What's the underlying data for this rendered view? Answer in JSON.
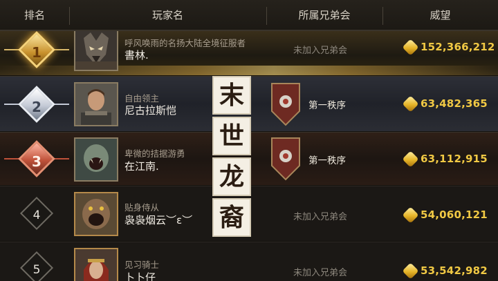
{
  "header": {
    "rank": "排名",
    "player": "玩家名",
    "guild": "所属兄弟会",
    "prestige": "威望"
  },
  "rows": [
    {
      "rank": "1",
      "title": "呼风唤雨的名扬大陆全境征服者",
      "name": "書林.",
      "guild": "未加入兄弟会",
      "prestige": "152,366,212"
    },
    {
      "rank": "2",
      "title": "自由领主",
      "name": "尼古拉斯恺",
      "guild": "第一秩序",
      "prestige": "63,482,365"
    },
    {
      "rank": "3",
      "title": "卑微的拮据游勇",
      "name": "在江南.",
      "guild": "第一秩序",
      "prestige": "63,112,915"
    },
    {
      "rank": "4",
      "title": "贴身侍从",
      "name": "袅袅烟云︶ε︶",
      "guild": "未加入兄弟会",
      "prestige": "54,060,121"
    },
    {
      "rank": "5",
      "title": "见习骑士",
      "name": "卜卜仔",
      "guild": "未加入兄弟会",
      "prestige": "53,542,982"
    }
  ],
  "banner": [
    "末",
    "世",
    "龙",
    "裔"
  ],
  "colors": {
    "gold": "#f1c944",
    "rank1": "#e0a534",
    "rank2": "#c4cad6",
    "rank3": "#c0523a",
    "guildShield": "#7a2a20"
  },
  "icons": {
    "prestige": "prestige-gem-icon",
    "guild": "guild-shield-icon"
  }
}
